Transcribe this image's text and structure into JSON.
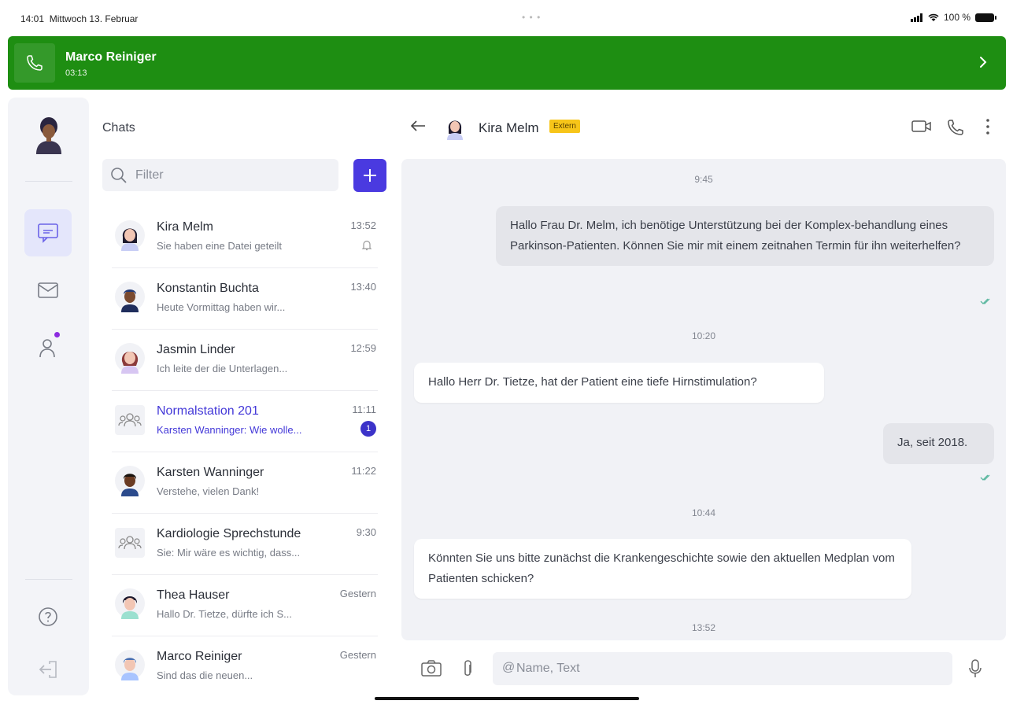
{
  "status_bar": {
    "time": "14:01",
    "date": "Mittwoch 13. Februar",
    "battery": "100 %"
  },
  "call_banner": {
    "name": "Marco Reiniger",
    "duration": "03:13",
    "color": "#1e8e12"
  },
  "rail": {
    "items": [
      {
        "icon": "chat-icon",
        "active": true
      },
      {
        "icon": "mail-icon",
        "active": false
      },
      {
        "icon": "contacts-icon",
        "active": false,
        "notification_dot": true
      }
    ],
    "bottom_items": [
      {
        "icon": "help-icon"
      },
      {
        "icon": "logout-icon"
      }
    ]
  },
  "chats_panel": {
    "title": "Chats",
    "filter_placeholder": "Filter",
    "accent": "#4a3ae0",
    "items": [
      {
        "name": "Kira Melm",
        "preview": "Sie haben eine Datei geteilt",
        "time": "13:52",
        "muted": true,
        "avatar": "person"
      },
      {
        "name": "Konstantin Buchta",
        "preview": "Heute Vormittag haben wir...",
        "time": "13:40",
        "avatar": "person"
      },
      {
        "name": "Jasmin Linder",
        "preview": "Ich leite der die Unterlagen...",
        "time": "12:59",
        "avatar": "person"
      },
      {
        "name": "Normalstation 201",
        "preview": "Karsten Wanninger: Wie wolle...",
        "time": "11:11",
        "badge": "1",
        "group": true,
        "highlight": true
      },
      {
        "name": "Karsten Wanninger",
        "preview": "Verstehe, vielen Dank!",
        "time": "11:22",
        "avatar": "person"
      },
      {
        "name": "Kardiologie Sprechstunde",
        "preview": "Sie: Mir wäre es wichtig, dass...",
        "time": "9:30",
        "group": true
      },
      {
        "name": "Thea Hauser",
        "preview": "Hallo Dr. Tietze, dürfte ich S...",
        "time": "Gestern",
        "avatar": "person"
      },
      {
        "name": "Marco Reiniger",
        "preview": "Sind das die neuen...",
        "time": "Gestern",
        "avatar": "person"
      }
    ]
  },
  "conversation": {
    "contact_name": "Kira Melm",
    "tag": "Extern",
    "tag_color": "#f7c519",
    "messages": [
      {
        "type": "timestamp",
        "text": "9:45"
      },
      {
        "type": "out",
        "text": "Hallo Frau Dr. Melm, ich benötige Unterstützung bei der Komplex-behandlung eines Parkinson-Patienten. Können Sie mir mit einem zeitnahen Termin für ihn weiterhelfen?"
      },
      {
        "type": "timestamp",
        "text": "10:20"
      },
      {
        "type": "in",
        "text": "Hallo Herr Dr. Tietze, hat der Patient eine tiefe Hirnstimulation?"
      },
      {
        "type": "out",
        "text": "Ja, seit 2018."
      },
      {
        "type": "timestamp",
        "text": "10:44"
      },
      {
        "type": "in",
        "text": "Könnten Sie uns bitte zunächst die Krankengeschichte sowie den aktuellen Medplan vom Patienten schicken?"
      },
      {
        "type": "timestamp",
        "text": "13:52"
      }
    ]
  },
  "composer": {
    "placeholder": "Name, Text",
    "at_symbol": "@"
  }
}
